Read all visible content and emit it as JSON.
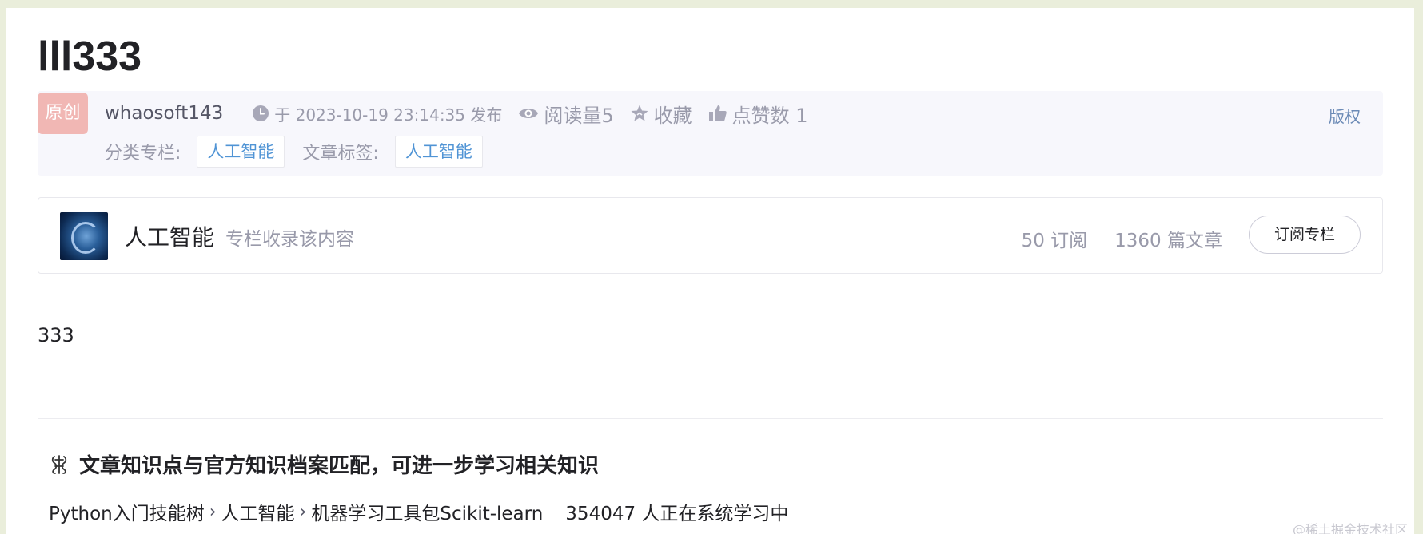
{
  "article": {
    "title": "lll333",
    "content": "333"
  },
  "meta": {
    "badge": "原创",
    "author": "whaosoft143",
    "time": "于 2023-10-19 23:14:35 发布",
    "reads": "阅读量5",
    "favorite": "收藏",
    "likes": "点赞数 1",
    "copyright": "版权",
    "category_label": "分类专栏:",
    "category_tag": "人工智能",
    "tags_label": "文章标签:",
    "article_tag": "人工智能"
  },
  "column": {
    "name": "人工智能",
    "desc": "专栏收录该内容",
    "subscribers": "50 订阅",
    "articles": "1360 篇文章",
    "subscribe_label": "订阅专栏"
  },
  "knowledge": {
    "title": "文章知识点与官方知识档案匹配，可进一步学习相关知识",
    "path": [
      "Python入门技能树",
      "人工智能",
      "机器学习工具包Scikit-learn"
    ],
    "learners": "354047 人正在系统学习中"
  },
  "watermark": "@稀土掘金技术社区",
  "colors": {
    "badge_bg": "#f1b7b4",
    "tag_text": "#5094d5",
    "copyright_text": "#6b8ab6",
    "meta_bg": "#f7f7fc"
  },
  "icons": [
    "clock-icon",
    "eye-icon",
    "star-icon",
    "thumb-up-icon",
    "knowledge-icon",
    "chevron-right-icon"
  ]
}
